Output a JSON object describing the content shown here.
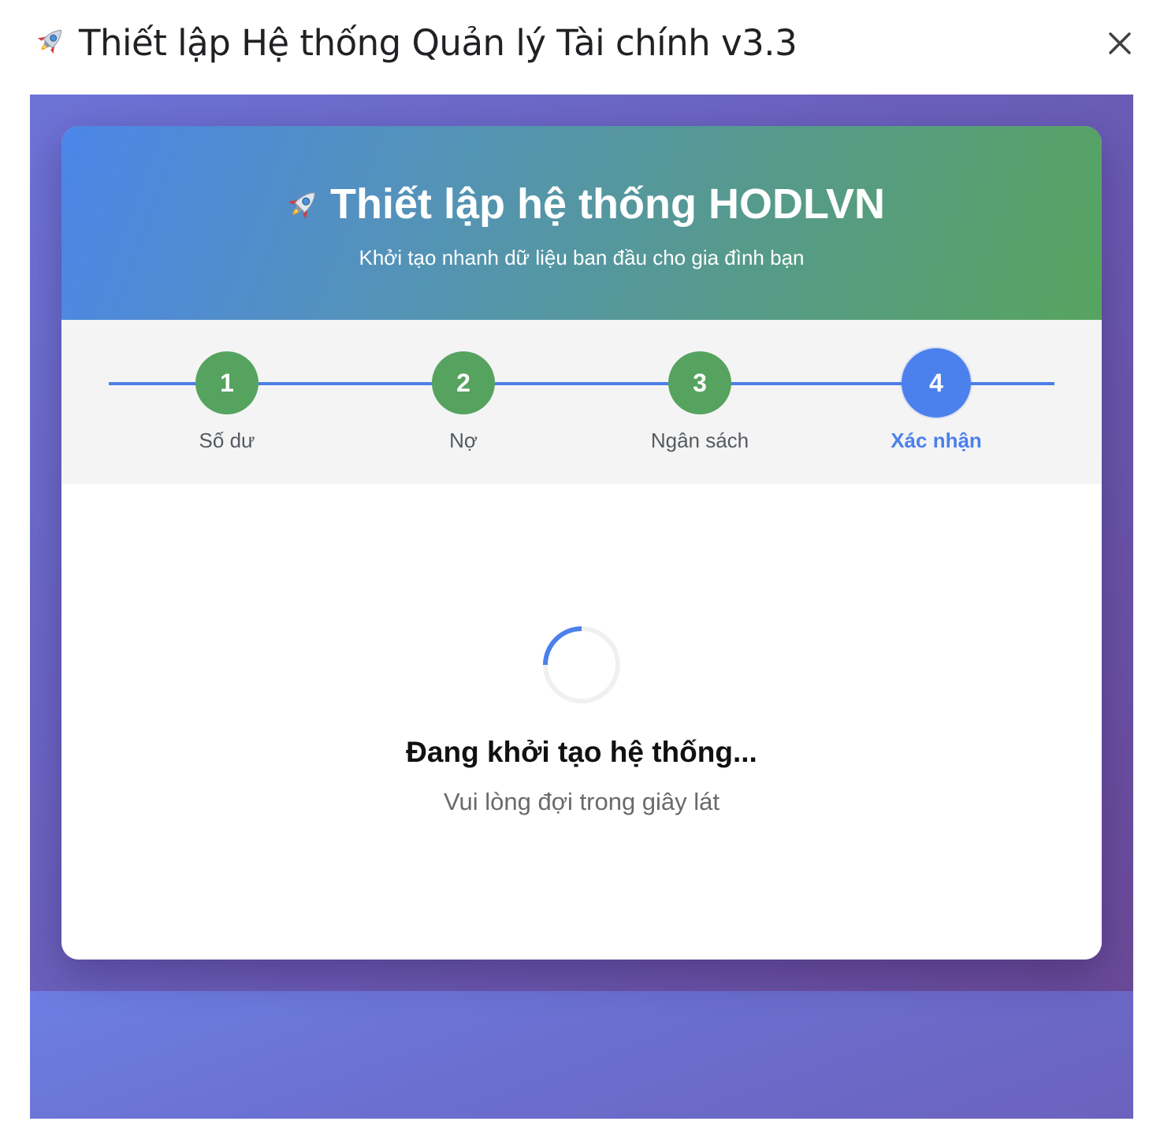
{
  "dialog": {
    "title": "Thiết lập Hệ thống Quản lý Tài chính v3.3",
    "title_icon": "rocket-icon",
    "close_icon": "close-icon"
  },
  "card": {
    "title": "Thiết lập hệ thống HODLVN",
    "title_icon": "rocket-icon",
    "subtitle": "Khởi tạo nhanh dữ liệu ban đầu cho gia đình bạn"
  },
  "stepper": {
    "steps": [
      {
        "number": "1",
        "label": "Số dư",
        "state": "done"
      },
      {
        "number": "2",
        "label": "Nợ",
        "state": "done"
      },
      {
        "number": "3",
        "label": "Ngân sách",
        "state": "done"
      },
      {
        "number": "4",
        "label": "Xác nhận",
        "state": "active"
      }
    ]
  },
  "loading": {
    "title": "Đang khởi tạo hệ thống...",
    "subtitle": "Vui lòng đợi trong giây lát",
    "spinner_icon": "loading-spinner-icon"
  },
  "colors": {
    "step_done": "#55a35f",
    "step_active": "#4c80ec",
    "background_gradient_start": "#6b7ddd",
    "background_gradient_end": "#6a4e9e",
    "header_gradient_start": "#4c85e8",
    "header_gradient_end": "#57a45f"
  }
}
